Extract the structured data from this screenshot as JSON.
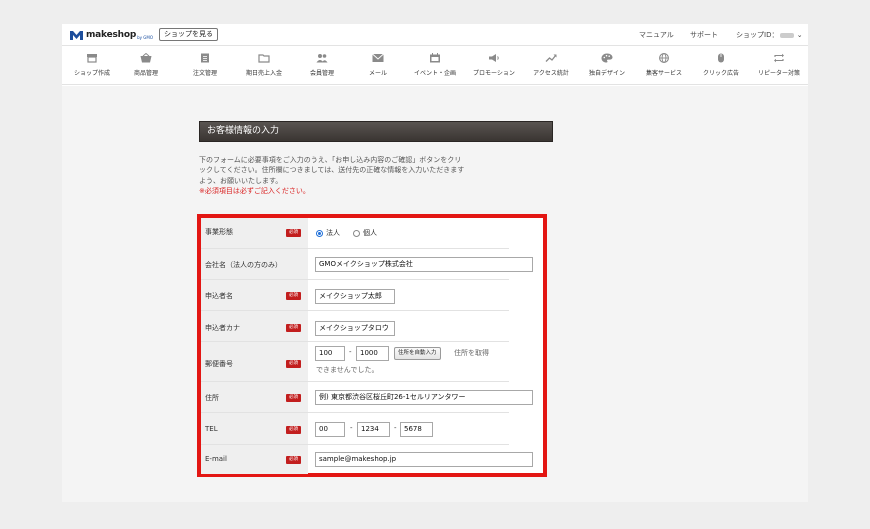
{
  "topbar": {
    "logo_text": "makeshop",
    "logo_sub": "by GMO",
    "shop_button": "ショップを見る",
    "links": {
      "manual": "マニュアル",
      "support": "サポート",
      "shop_id": "ショップID："
    },
    "chevron": "⌄"
  },
  "nav": {
    "items": [
      {
        "label": "ショップ作成",
        "icon": "shop-create-icon"
      },
      {
        "label": "商品管理",
        "icon": "basket-icon"
      },
      {
        "label": "注文管理",
        "icon": "clipboard-icon"
      },
      {
        "label": "期日売上入金",
        "icon": "folder-icon"
      },
      {
        "label": "会員管理",
        "icon": "members-icon"
      },
      {
        "label": "メール",
        "icon": "mail-icon"
      },
      {
        "label": "イベント・企画",
        "icon": "calendar-icon"
      },
      {
        "label": "プロモーション",
        "icon": "megaphone-icon"
      },
      {
        "label": "アクセス統計",
        "icon": "trend-icon"
      },
      {
        "label": "独自デザイン",
        "icon": "palette-icon"
      },
      {
        "label": "集客サービス",
        "icon": "globe-icon"
      },
      {
        "label": "クリック広告",
        "icon": "mouse-icon"
      },
      {
        "label": "リピーター対策",
        "icon": "repeat-icon"
      }
    ]
  },
  "section": {
    "title": "お客様情報の入力",
    "intro_lines": [
      "下のフォームに必要事項をご入力のうえ、「お申し込み内容のご確認」ボタンをクリ",
      "ックしてください。住所欄につきましては、送付先の正確な情報を入力いただきます",
      "よう、お願いいたします。"
    ],
    "required_note": "※必須項目は必ずご記入ください。"
  },
  "form": {
    "required_badge": "必須",
    "business_type": {
      "label": "事業形態",
      "option_corp": "法人",
      "option_indiv": "個人",
      "selected": "法人"
    },
    "company": {
      "label": "会社名（法人の方のみ）",
      "value": "GMOメイクショップ株式会社"
    },
    "applicant": {
      "label": "申込者名",
      "value": "メイクショップ太郎"
    },
    "applicant_kana": {
      "label": "申込者カナ",
      "value": "メイクショップタロウ"
    },
    "postal": {
      "label": "郵便番号",
      "part1": "100",
      "separator": "-",
      "part2": "1000",
      "auto_button": "住所を自動入力",
      "note_1": "住所を取得",
      "note_2": "できませんでした。"
    },
    "address": {
      "label": "住所",
      "value": "例) 東京都渋谷区桜丘町26-1セルリアンタワー"
    },
    "tel": {
      "label": "TEL",
      "part1": "00",
      "part2": "1234",
      "part3": "5678",
      "separator": "-"
    },
    "email": {
      "label": "E-mail",
      "value": "sample@makeshop.jp"
    }
  },
  "colors": {
    "accent_red": "#e31613",
    "required_red": "#c21e1e",
    "header_dark": "#3a3532",
    "radio_blue": "#1e6fd9"
  }
}
